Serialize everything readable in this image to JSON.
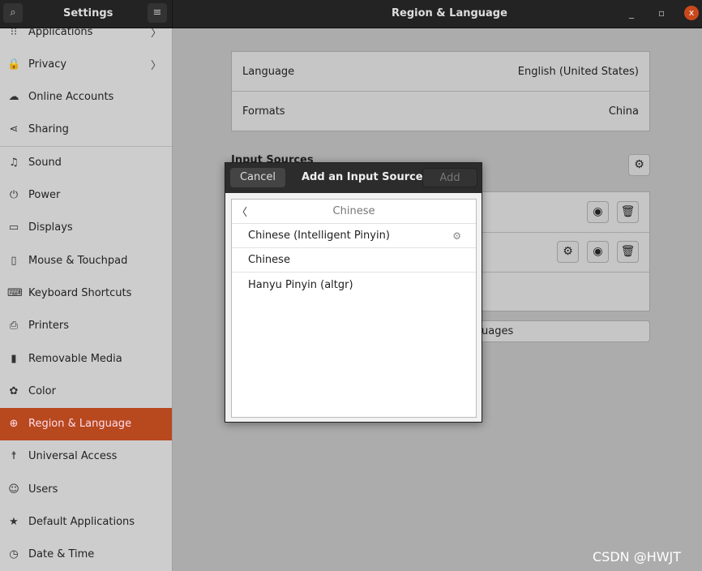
{
  "header": {
    "sidebar_title": "Settings",
    "title": "Region & Language",
    "search_icon": "search-icon",
    "menu_icon": "hamburger-icon"
  },
  "sidebar": {
    "items": [
      {
        "label": "Applications",
        "icon": "⁝⁝",
        "chev": true
      },
      {
        "label": "Privacy",
        "icon": "🔒",
        "chev": true
      },
      {
        "label": "Online Accounts",
        "icon": "☁"
      },
      {
        "label": "Sharing",
        "icon": "⋖"
      },
      {
        "label": "Sound",
        "icon": "♫"
      },
      {
        "label": "Power",
        "icon": "⏻"
      },
      {
        "label": "Displays",
        "icon": "▭"
      },
      {
        "label": "Mouse & Touchpad",
        "icon": "▯"
      },
      {
        "label": "Keyboard Shortcuts",
        "icon": "⌨"
      },
      {
        "label": "Printers",
        "icon": "⎙"
      },
      {
        "label": "Removable Media",
        "icon": "▮"
      },
      {
        "label": "Color",
        "icon": "✿"
      },
      {
        "label": "Region & Language",
        "icon": "⊕",
        "selected": true
      },
      {
        "label": "Universal Access",
        "icon": "☨"
      },
      {
        "label": "Users",
        "icon": "☺"
      },
      {
        "label": "Default Applications",
        "icon": "★"
      },
      {
        "label": "Date & Time",
        "icon": "◷"
      }
    ]
  },
  "main": {
    "language_label": "Language",
    "language_value": "English (United States)",
    "formats_label": "Formats",
    "formats_value": "China",
    "input_sources_label": "Input Sources",
    "manage_languages_partial": "uages"
  },
  "dialog": {
    "title": "Add an Input Source",
    "cancel": "Cancel",
    "add": "Add",
    "group": "Chinese",
    "items": [
      "Chinese (Intelligent Pinyin)",
      "Chinese",
      "Hanyu Pinyin (altgr)"
    ]
  },
  "watermark": "CSDN @HWJT",
  "colors": {
    "accent": "#b8481e"
  }
}
